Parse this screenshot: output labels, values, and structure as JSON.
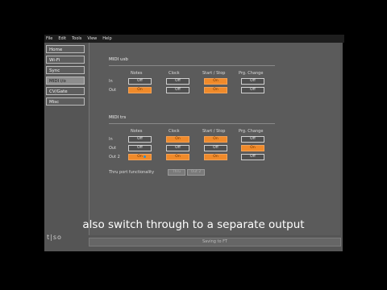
{
  "menu": [
    "File",
    "Edit",
    "Tools",
    "View",
    "Help"
  ],
  "sidebar": {
    "items": [
      {
        "label": "Home",
        "active": false
      },
      {
        "label": "Wi-Fi",
        "active": false
      },
      {
        "label": "Sync",
        "active": false
      },
      {
        "label": "MIDI i/o",
        "active": true
      },
      {
        "label": "CV/Gate",
        "active": false
      },
      {
        "label": "Misc",
        "active": false
      }
    ],
    "logo": "t|so"
  },
  "midi_usb": {
    "title": "MIDI usb",
    "columns": [
      "Notes",
      "Clock",
      "Start / Stop",
      "Prg. Change"
    ],
    "rows": [
      {
        "label": "In",
        "cells": [
          {
            "t": "Off",
            "on": false
          },
          {
            "t": "Off",
            "on": false
          },
          {
            "t": "On",
            "on": true
          },
          {
            "t": "Off",
            "on": false
          }
        ]
      },
      {
        "label": "Out",
        "cells": [
          {
            "t": "On",
            "on": true
          },
          {
            "t": "Off",
            "on": false
          },
          {
            "t": "On",
            "on": true
          },
          {
            "t": "Off",
            "on": false
          }
        ]
      }
    ]
  },
  "midi_trs": {
    "title": "MIDI trs",
    "columns": [
      "Notes",
      "Clock",
      "Start / Stop",
      "Prg. Change"
    ],
    "rows": [
      {
        "label": "In",
        "cells": [
          {
            "t": "Off",
            "on": false
          },
          {
            "t": "On",
            "on": true
          },
          {
            "t": "On",
            "on": true
          },
          {
            "t": "Off",
            "on": false
          }
        ]
      },
      {
        "label": "Out",
        "cells": [
          {
            "t": "Off",
            "on": false
          },
          {
            "t": "Off",
            "on": false
          },
          {
            "t": "Off",
            "on": false
          },
          {
            "t": "On",
            "on": true
          }
        ]
      },
      {
        "label": "Out 2",
        "cells": [
          {
            "t": "On",
            "on": true
          },
          {
            "t": "On",
            "on": true
          },
          {
            "t": "On",
            "on": true
          },
          {
            "t": "Off",
            "on": false
          }
        ]
      }
    ],
    "thru": {
      "label": "Thru port functionality",
      "option_a": "Thru",
      "option_b": "Out 2"
    }
  },
  "status": "Saving to FT",
  "subtitle": "also switch through to a separate output"
}
